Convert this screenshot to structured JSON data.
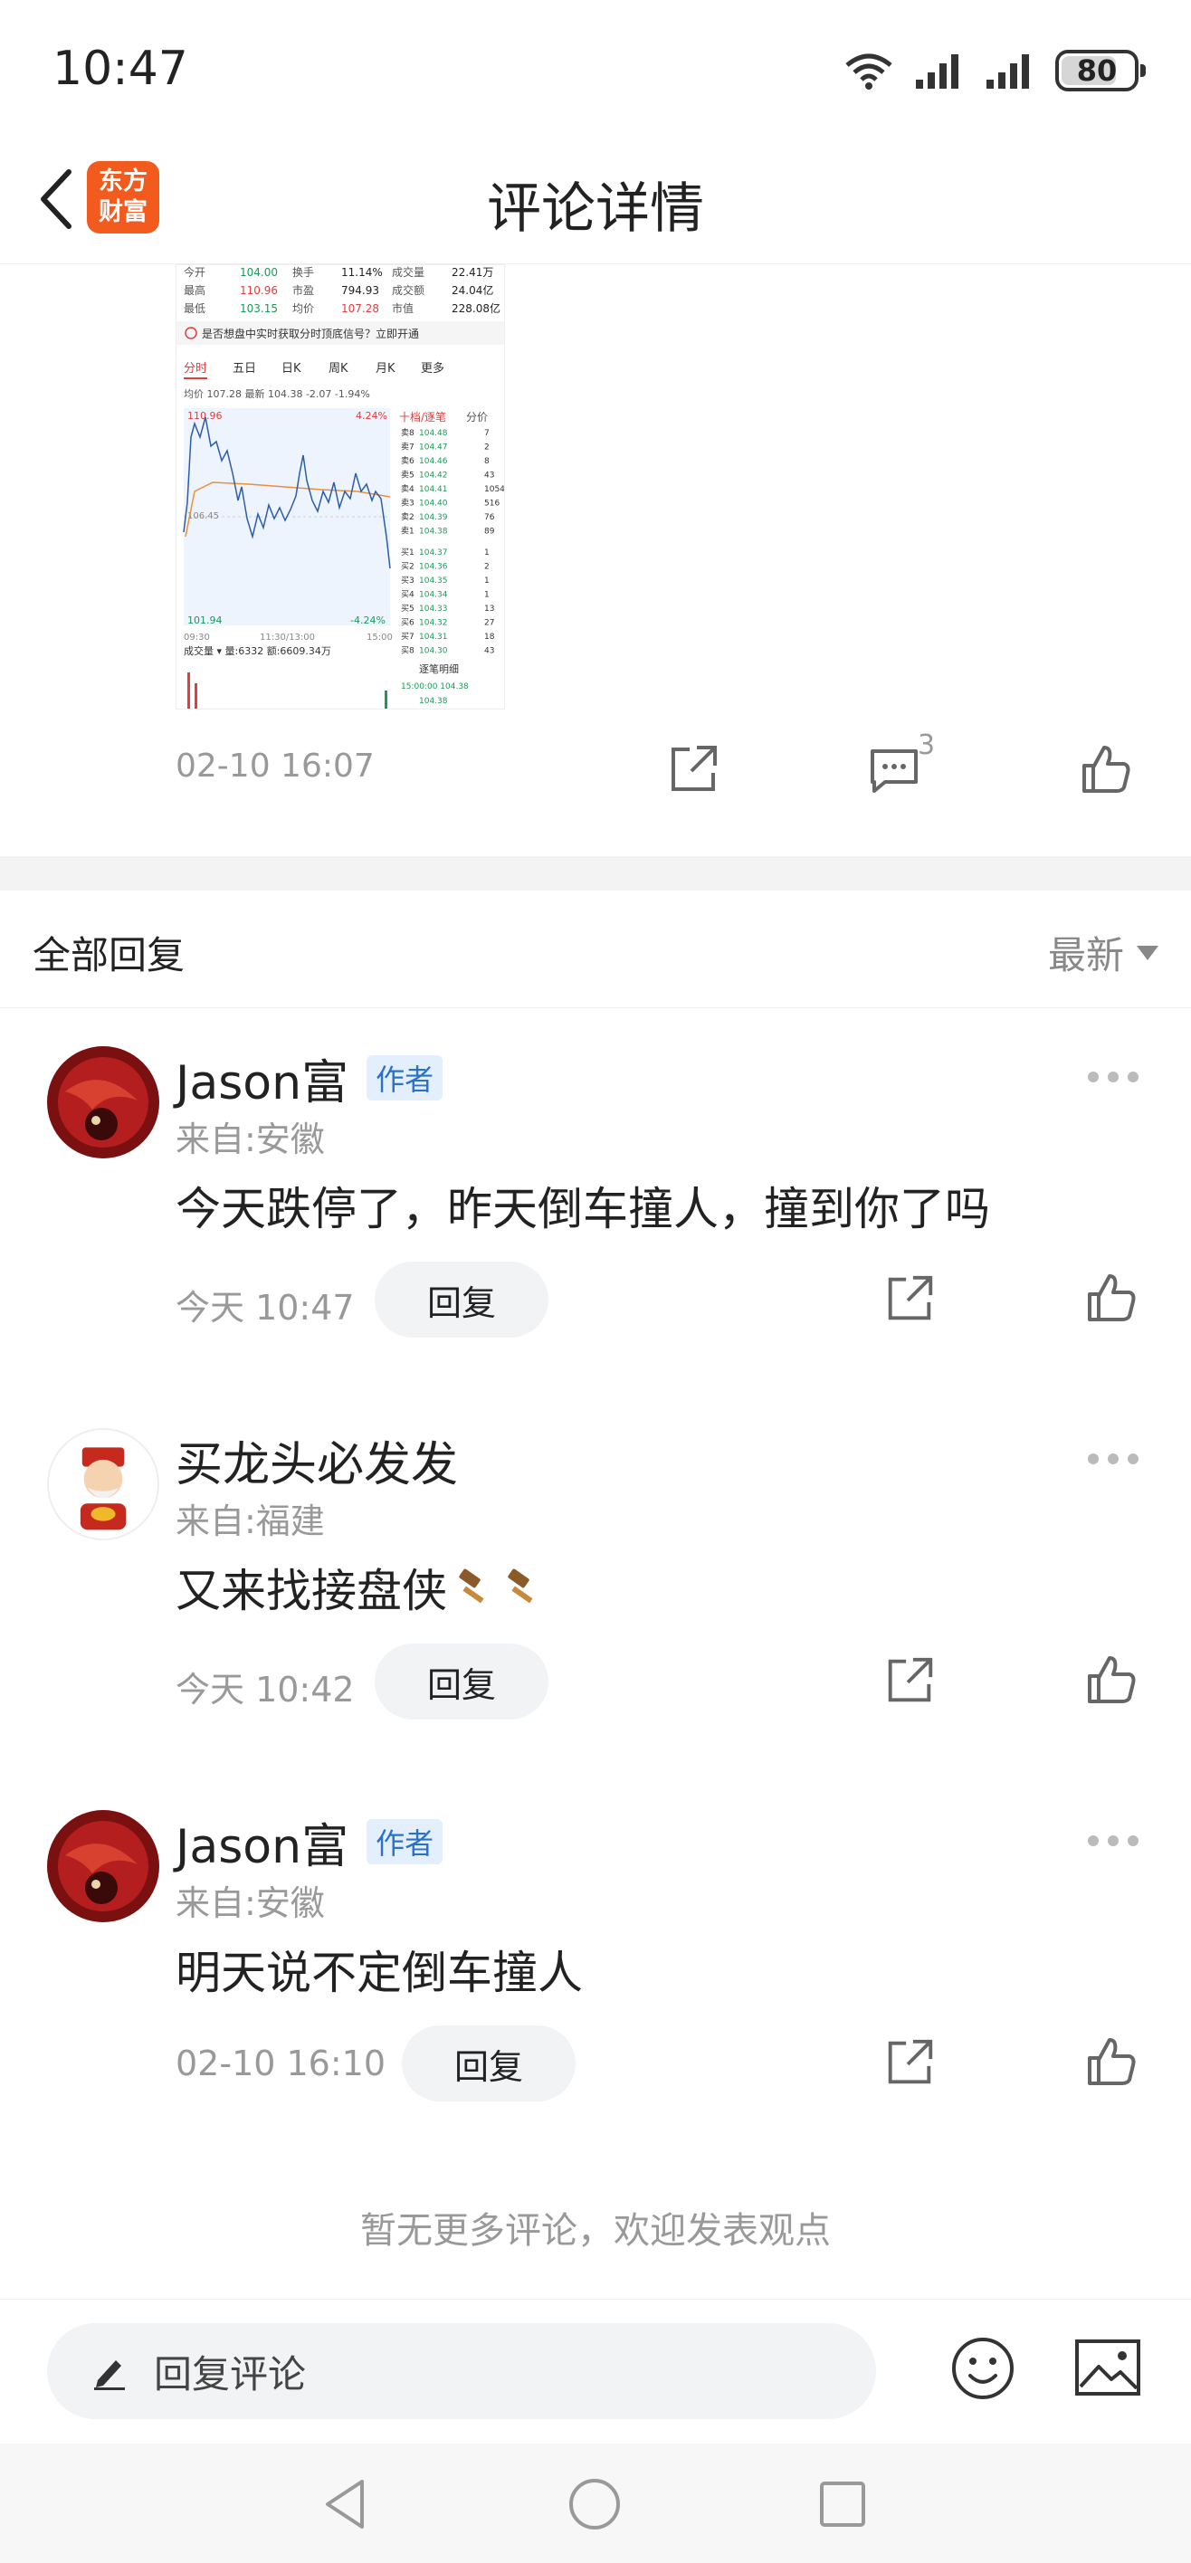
{
  "status_bar": {
    "time": "10:47",
    "battery": "80"
  },
  "header": {
    "title": "评论详情",
    "logo_line1": "东方",
    "logo_line2": "财富"
  },
  "post": {
    "time": "02-10 16:07",
    "comment_count": "3",
    "chart": {
      "open_label": "今开",
      "open": "104.00",
      "high_label": "最高",
      "high": "110.96",
      "low_label": "最低",
      "low": "103.15",
      "turnover_label": "换手",
      "turnover": "11.14%",
      "pe_label": "市盈",
      "pe": "794.93",
      "avg_label": "均价",
      "avg": "107.28",
      "volume_label": "成交量",
      "volume": "22.41万",
      "amount_label": "成交额",
      "amount": "24.04亿",
      "mcap_label": "市值",
      "mcap": "228.08亿",
      "notice": "是否想盘中实时获取分时顶底信号？立即开通",
      "tabs": [
        "分时",
        "五日",
        "日K",
        "周K",
        "月K",
        "更多"
      ],
      "line_info": "均价 107.28  最新 104.38  -2.07  -1.94%",
      "top_price": "110.96",
      "top_pct": "4.24%",
      "bottom_price": "101.94",
      "bottom_pct": "-4.24%",
      "mid_price": "106.45",
      "time_start": "09:30",
      "time_mid": "11:30/13:00",
      "time_end": "15:00",
      "vol_line": "成交量 ▾  量:6332 额:6609.34万",
      "book_title": "十档/逐笔",
      "book_tab2": "分价",
      "sells": [
        [
          "卖8",
          "104.48",
          "7"
        ],
        [
          "卖7",
          "104.47",
          "2"
        ],
        [
          "卖6",
          "104.46",
          "8"
        ],
        [
          "卖5",
          "104.42",
          "43"
        ],
        [
          "卖4",
          "104.41",
          "1054"
        ],
        [
          "卖3",
          "104.40",
          "516"
        ],
        [
          "卖2",
          "104.39",
          "76"
        ],
        [
          "卖1",
          "104.38",
          "89"
        ]
      ],
      "buys": [
        [
          "买1",
          "104.37",
          "1"
        ],
        [
          "买2",
          "104.36",
          "2"
        ],
        [
          "买3",
          "104.35",
          "1"
        ],
        [
          "买4",
          "104.34",
          "1"
        ],
        [
          "买5",
          "104.33",
          "13"
        ],
        [
          "买6",
          "104.32",
          "27"
        ],
        [
          "买7",
          "104.31",
          "18"
        ],
        [
          "买8",
          "104.30",
          "43"
        ]
      ],
      "detail_title": "逐笔明细"
    }
  },
  "replies": {
    "title": "全部回复",
    "sort_label": "最新",
    "items": [
      {
        "name": "Jason富",
        "badge": "作者",
        "location": "来自:安徽",
        "text": "今天跌停了，昨天倒车撞人，撞到你了吗",
        "time": "今天 10:47",
        "reply_label": "回复",
        "avatar": "red"
      },
      {
        "name": "买龙头必发发",
        "badge": "",
        "location": "来自:福建",
        "text": "又来找接盘侠",
        "time": "今天 10:42",
        "reply_label": "回复",
        "avatar": "fortune"
      },
      {
        "name": "Jason富",
        "badge": "作者",
        "location": "来自:安徽",
        "text": "明天说不定倒车撞人",
        "time": "02-10 16:10",
        "reply_label": "回复",
        "avatar": "red"
      }
    ],
    "no_more": "暂无更多评论，欢迎发表观点"
  },
  "bottom_bar": {
    "input_placeholder": "回复评论"
  },
  "colors": {
    "brand": "#f25a1e",
    "badge_text": "#2a72c9",
    "badge_bg": "#e3effc",
    "price_up": "#e23c3c",
    "price_down": "#1a9a5a"
  }
}
